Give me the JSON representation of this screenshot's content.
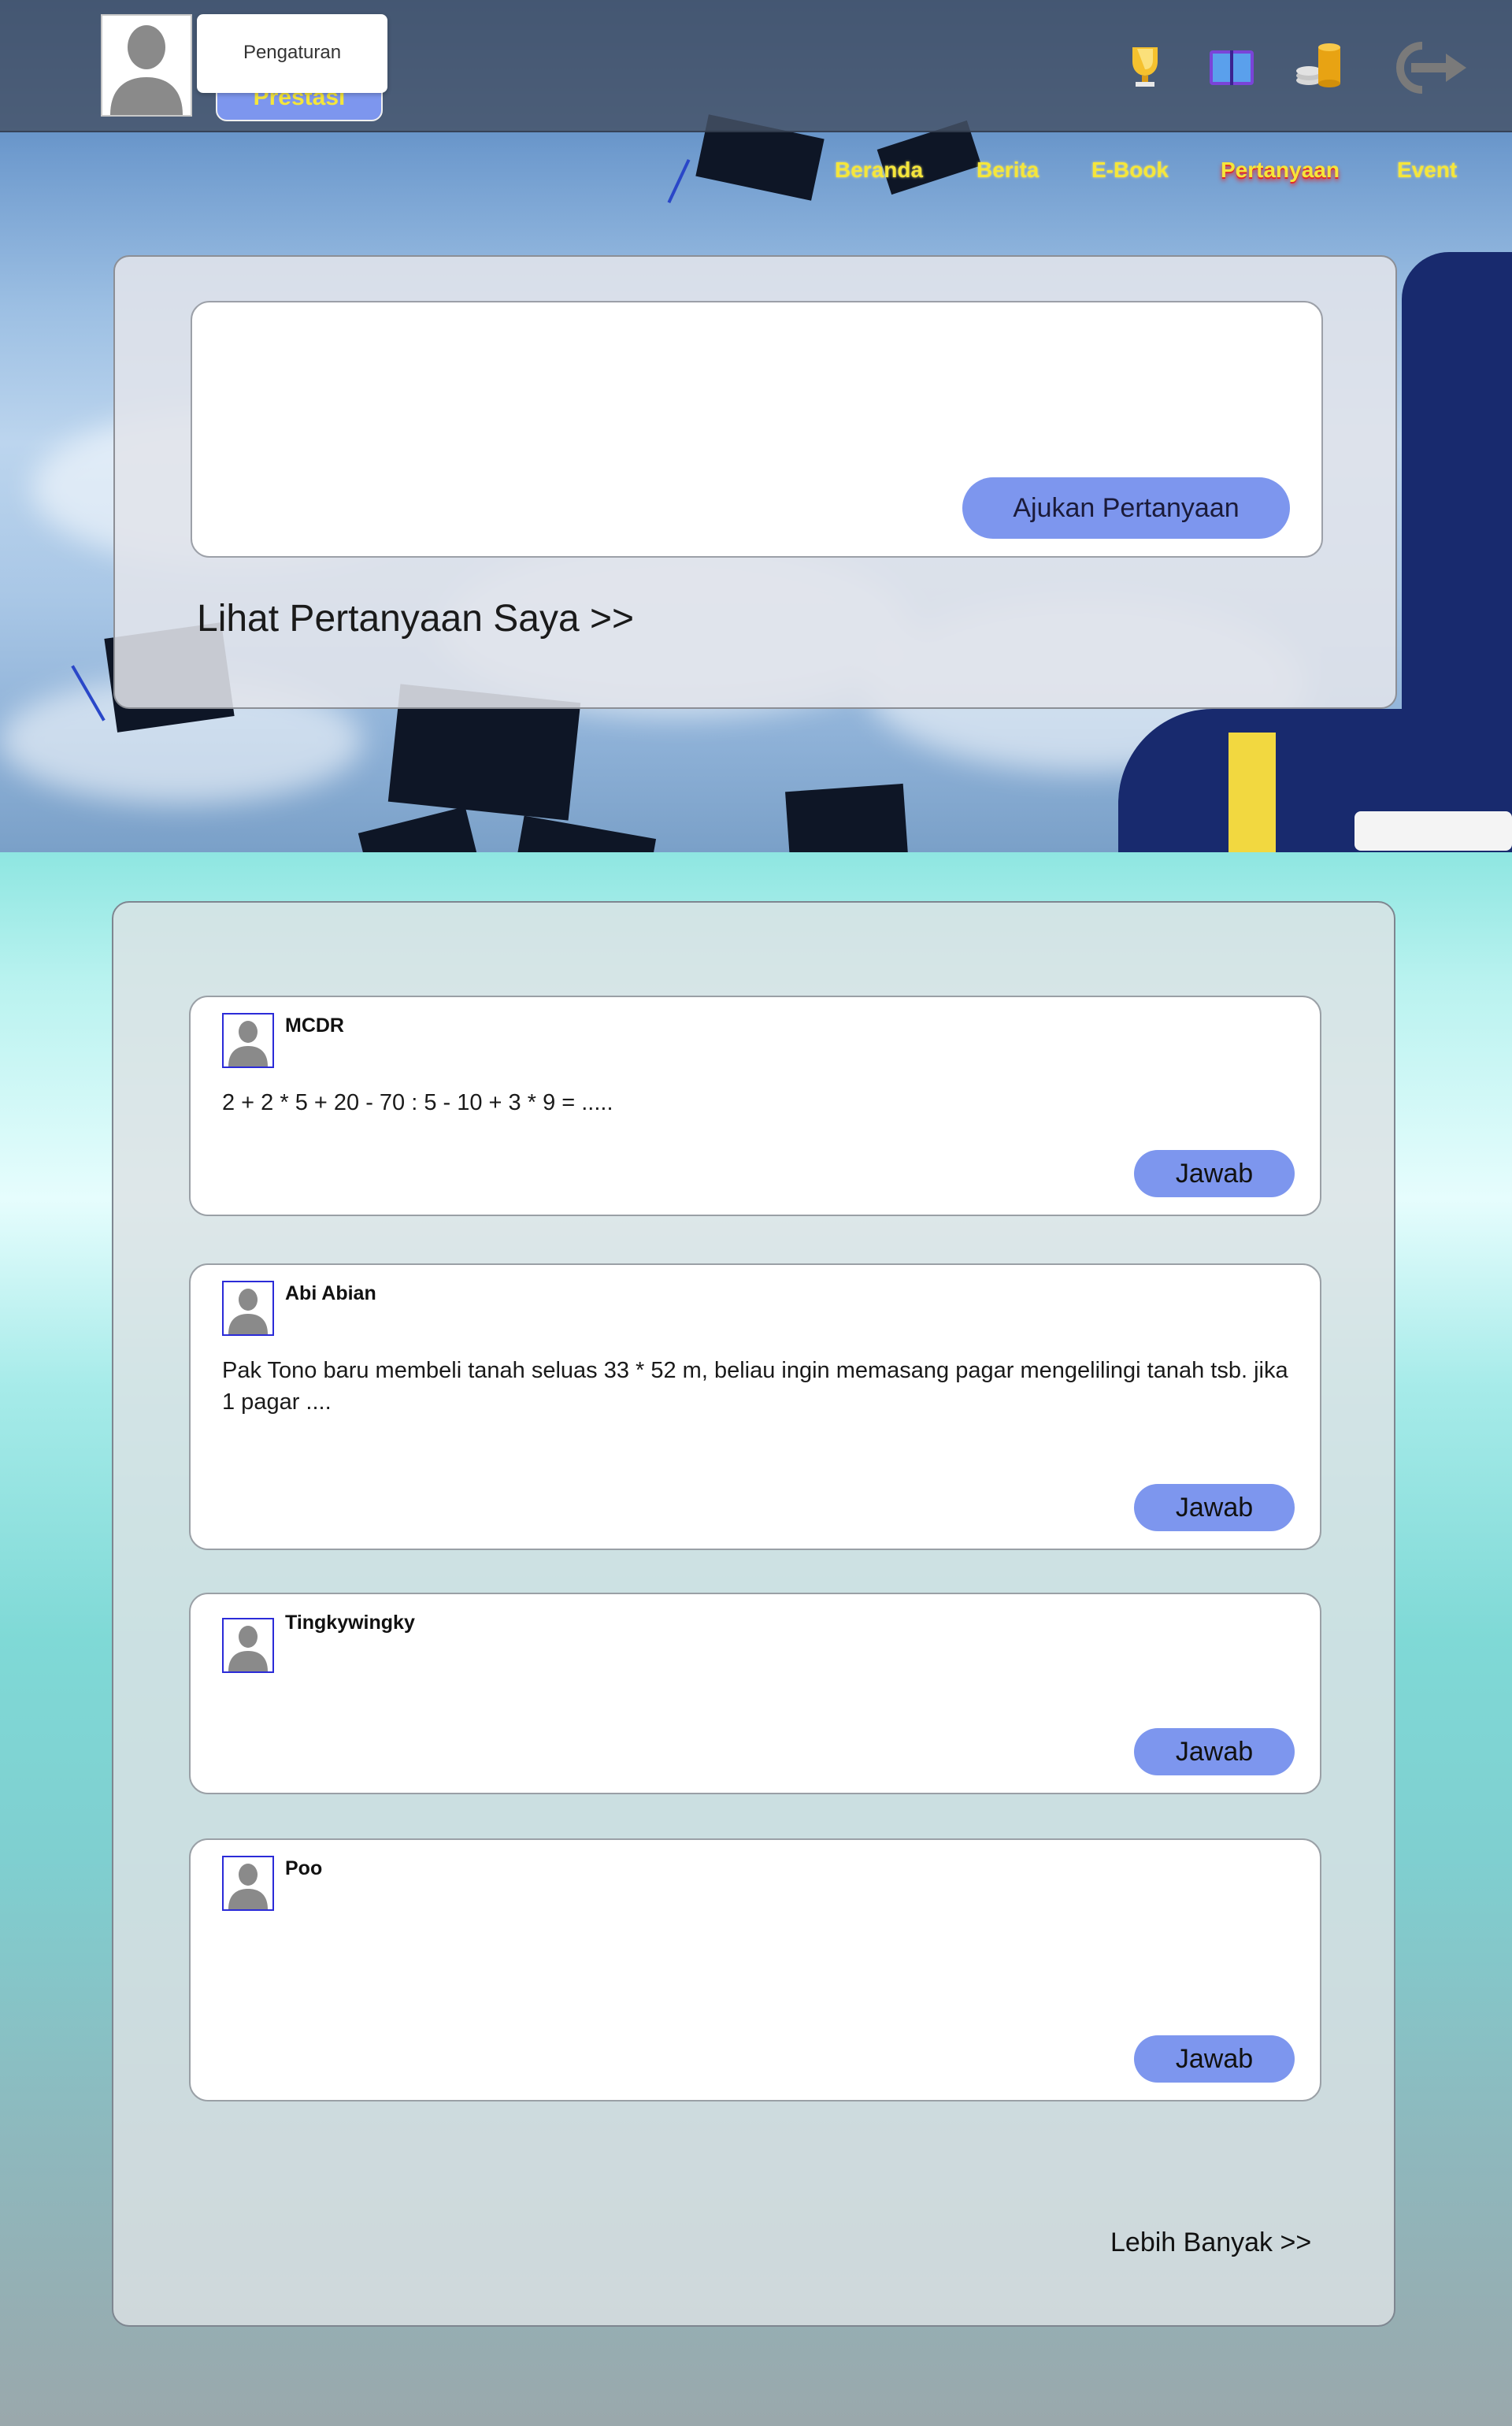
{
  "header": {
    "settings_label": "Pengaturan",
    "prestasi_label": "Prestasi",
    "icons": [
      "trophy-icon",
      "book-icon",
      "coins-icon",
      "logout-icon"
    ]
  },
  "nav": {
    "items": [
      {
        "label": "Beranda"
      },
      {
        "label": "Berita"
      },
      {
        "label": "E-Book"
      },
      {
        "label": "Pertanyaan",
        "active": true
      },
      {
        "label": "Event"
      }
    ]
  },
  "ask": {
    "question_value": "",
    "button_label": "Ajukan Pertanyaan",
    "my_questions_link": "Lihat Pertanyaan Saya >>"
  },
  "questions": [
    {
      "user": "MCDR",
      "text": "2 + 2 * 5 + 20 - 70  : 5 - 10 + 3 * 9 = .....",
      "button": "Jawab"
    },
    {
      "user": "Abi Abian",
      "text": "Pak Tono baru membeli tanah seluas 33 * 52 m, beliau ingin memasang pagar mengelilingi tanah tsb. jika 1 pagar ....",
      "button": "Jawab"
    },
    {
      "user": "Tingkywingky",
      "text": "",
      "button": "Jawab"
    },
    {
      "user": "Poo",
      "text": "",
      "button": "Jawab"
    }
  ],
  "more_link": "Lebih Banyak >>",
  "colors": {
    "accent_button": "#7d96ee",
    "nav_text": "#f5e63a",
    "nav_active_glow": "#e12a2a",
    "avatar_border": "#2b2bd8"
  }
}
